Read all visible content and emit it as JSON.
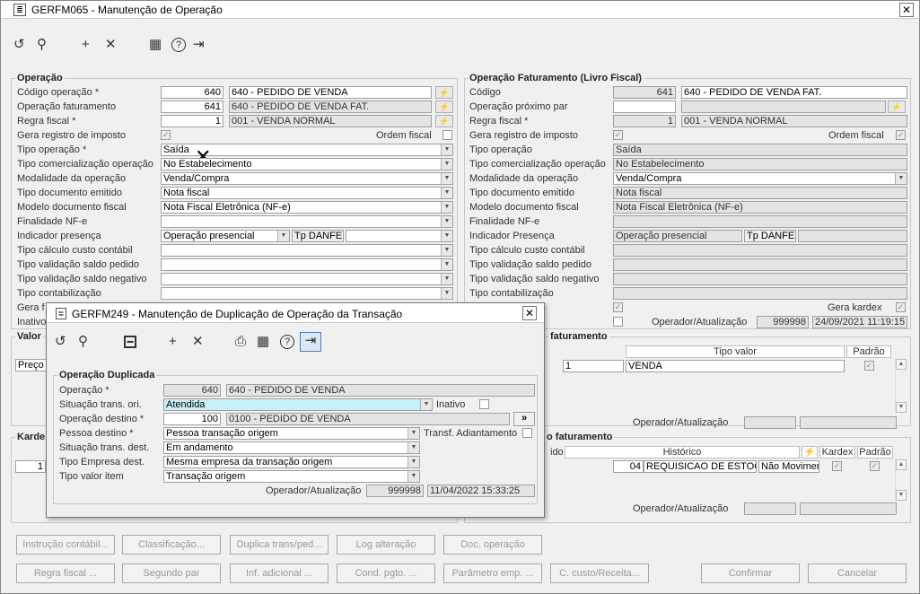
{
  "window": {
    "title": "GERFM065 - Manutenção de Operação",
    "close": "✕"
  },
  "toolbar": {
    "undo": "↺",
    "search": "⚲",
    "add": "+",
    "delete": "✕",
    "calendar": "▦",
    "help": "?",
    "exit": "⇥"
  },
  "operacao": {
    "title": "Operação",
    "codigo_label": "Código operação *",
    "codigo_value": "640",
    "codigo_desc": "640 - PEDIDO DE VENDA",
    "fat_label": "Operação faturamento",
    "fat_value": "641",
    "fat_desc": "640 - PEDIDO DE VENDA FAT.",
    "regra_label": "Regra fiscal *",
    "regra_value": "1",
    "regra_desc": "001 - VENDA NORMAL",
    "gera_label": "Gera registro de imposto",
    "ordem_label": "Ordem fiscal",
    "tipo_op_label": "Tipo operação *",
    "tipo_op_value": "Saída",
    "tipo_com_label": "Tipo comercialização operação",
    "tipo_com_value": "No Estabelecimento",
    "modal_label": "Modalidade da operação",
    "modal_value": "Venda/Compra",
    "tipo_doc_label": "Tipo documento emitido",
    "tipo_doc_value": "Nota fiscal",
    "modelo_label": "Modelo documento fiscal",
    "modelo_value": "Nota Fiscal Eletrônica (NF-e)",
    "final_label": "Finalidade NF-e",
    "indicador_label": "Indicador presença",
    "indicador_value": "Operação presencial",
    "tp_danfe": "Tp DANFE",
    "custo_label": "Tipo cálculo custo contábil",
    "val_ped_label": "Tipo validação saldo pedido",
    "val_neg_label": "Tipo validação saldo negativo",
    "contab_label": "Tipo contabilização",
    "gera_f_label": "Gera f",
    "inativo_label": "Inativo"
  },
  "faturamento": {
    "title": "Operação Faturamento (Livro Fiscal)",
    "codigo_label": "Código",
    "codigo_value": "641",
    "codigo_desc": "640 - PEDIDO DE VENDA FAT.",
    "prox_label": "Operação próximo par",
    "regra_label": "Regra fiscal *",
    "regra_value": "1",
    "regra_desc": "001 - VENDA NORMAL",
    "gera_label": "Gera registro de imposto",
    "ordem_label": "Ordem fiscal",
    "tipo_op_label": "Tipo operação",
    "tipo_op_value": "Saída",
    "tipo_com_label": "Tipo comercialização operação",
    "tipo_com_value": "No Estabelecimento",
    "modal_label": "Modalidade da operação",
    "modal_value": "Venda/Compra",
    "tipo_doc_label": "Tipo documento emitido",
    "tipo_doc_value": "Nota fiscal",
    "modelo_label": "Modelo documento fiscal",
    "modelo_value": "Nota Fiscal Eletrônica (NF-e)",
    "final_label": "Finalidade NF-e",
    "indicador_label": "Indicador Presença",
    "indicador_value": "Operação presencial",
    "tp_danfe": "Tp DANFE",
    "custo_label": "Tipo cálculo custo contábil",
    "val_ped_label": "Tipo validação saldo pedido",
    "val_neg_label": "Tipo validação saldo negativo",
    "contab_label": "Tipo contabilização",
    "gera_kardex_label": "Gera kardex",
    "oper_label": "Operador/Atualização",
    "oper_value": "999998",
    "oper_date": "24/09/2021 11:19:15"
  },
  "valor": {
    "title": "Valor",
    "preco": "Preço",
    "fat_title": "faturamento",
    "col_tipo": "Tipo valor",
    "col_padrao": "Padrão",
    "row_num": "1",
    "row_tipo": "VENDA",
    "oper_label": "Operador/Atualização"
  },
  "kardex": {
    "title": "Karde",
    "row_num": "1",
    "fat_title": "o faturamento",
    "col_ido": "ido",
    "col_hist": "Histórico",
    "col_kardex": "Kardex",
    "col_padrao": "Padrão",
    "row_cod": "04",
    "row_hist": "REQUISICAO DE ESTOQU",
    "row_mov": "Não Movimen",
    "oper_label": "Operador/Atualização"
  },
  "dialog": {
    "title": "GERFM249 - Manutenção de Duplicação de Operação da Transação",
    "close": "✕",
    "group_title": "Operação Duplicada",
    "op_label": "Operação *",
    "op_value": "640",
    "op_desc": "640 - PEDIDO DE VENDA",
    "sit_label": "Situação trans. ori.",
    "sit_value": "Atendida",
    "inativo_label": "Inativo",
    "dest_label": "Operação destino *",
    "dest_value": "100",
    "dest_desc": "0100 - PEDIDO DE VENDA",
    "dest_btn": "»",
    "pessoa_label": "Pessoa destino *",
    "pessoa_value": "Pessoa transação origem",
    "transf_label": "Transf. Adiantamento",
    "sit_dest_label": "Situação trans. dest.",
    "sit_dest_value": "Em andamento",
    "empresa_label": "Tipo Empresa dest.",
    "empresa_value": "Mesma empresa da transação origem",
    "valor_label": "Tipo valor item",
    "valor_value": "Transação origem",
    "oper_label": "Operador/Atualização",
    "oper_value": "999998",
    "oper_date": "11/04/2022 15:33:25"
  },
  "buttons": {
    "instrucao": "Instrução contábil...",
    "classificacao": "Classificação...",
    "duplica": "Duplica trans/ped...",
    "log": "Log alteração",
    "doc": "Doc. operação",
    "regra": "Regra fiscal ...",
    "segundo": "Segundo par",
    "inf": "Inf. adicional ...",
    "cond": "Cond. pgto. ...",
    "parametro": "Parâmetro emp. ...",
    "custo": "C. custo/Receita...",
    "confirmar": "Confirmar",
    "cancelar": "Cancelar"
  }
}
